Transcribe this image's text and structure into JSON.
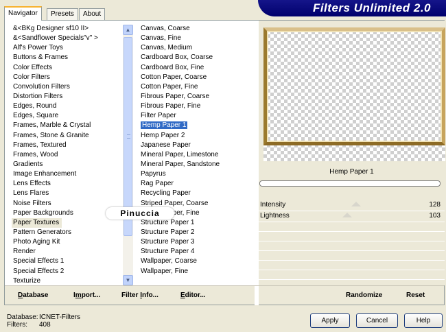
{
  "tabs": [
    "Navigator",
    "Presets",
    "About"
  ],
  "banner_title": "Filters Unlimited 2.0",
  "categories": [
    "&<BKg Designer sf10 II>",
    "&<Sandflower Specials\"v\" >",
    "Alf's Power Toys",
    "Buttons & Frames",
    "Color Effects",
    "Color Filters",
    "Convolution Filters",
    "Distortion Filters",
    "Edges, Round",
    "Edges, Square",
    "Frames, Marble & Crystal",
    "Frames, Stone & Granite",
    "Frames, Textured",
    "Frames, Wood",
    "Gradients",
    "Image Enhancement",
    "Lens Effects",
    "Lens Flares",
    "Noise Filters",
    "Paper Backgrounds",
    "Paper Textures",
    "Pattern Generators",
    "Photo Aging Kit",
    "Render",
    "Special Effects 1",
    "Special Effects 2",
    "Texturize"
  ],
  "selected_category": "Paper Textures",
  "filters": [
    "Canvas, Coarse",
    "Canvas, Fine",
    "Canvas, Medium",
    "Cardboard Box, Coarse",
    "Cardboard Box, Fine",
    "Cotton Paper, Coarse",
    "Cotton Paper, Fine",
    "Fibrous Paper, Coarse",
    "Fibrous Paper, Fine",
    "Filter Paper",
    "Hemp Paper 1",
    "Hemp Paper 2",
    "Japanese Paper",
    "Mineral Paper, Limestone",
    "Mineral Paper, Sandstone",
    "Papyrus",
    "Rag Paper",
    "Recycling Paper",
    "Striped Paper, Coarse",
    "Striped Paper, Fine",
    "Structure Paper 1",
    "Structure Paper 2",
    "Structure Paper 3",
    "Structure Paper 4",
    "Wallpaper, Coarse",
    "Wallpaper, Fine"
  ],
  "selected_filter": "Hemp Paper 1",
  "watermark": "Pinuccia",
  "preview_filter_name": "Hemp Paper 1",
  "sliders": [
    {
      "label": "Intensity",
      "value": "128",
      "fraction": 0.5
    },
    {
      "label": "Lightness",
      "value": "103",
      "fraction": 0.4
    }
  ],
  "footer_buttons": {
    "database": {
      "u": "D",
      "rest": "atabase"
    },
    "import": {
      "pre": "I",
      "u": "m",
      "rest": "port..."
    },
    "filter_info": {
      "pre": "Filter ",
      "u": "I",
      "rest": "nfo..."
    },
    "editor": {
      "u": "E",
      "rest": "ditor..."
    },
    "randomize": "Randomize",
    "reset": "Reset"
  },
  "status": {
    "database_label": "Database:",
    "database_value": "ICNET-Filters",
    "filters_label": "Filters:",
    "filters_value": "408"
  },
  "buttons": {
    "apply": "Apply",
    "cancel": "Cancel",
    "help": "Help"
  },
  "colors": {
    "selection": "#316ac5",
    "banner": "#00006c",
    "frame_gold": "#b49042"
  }
}
